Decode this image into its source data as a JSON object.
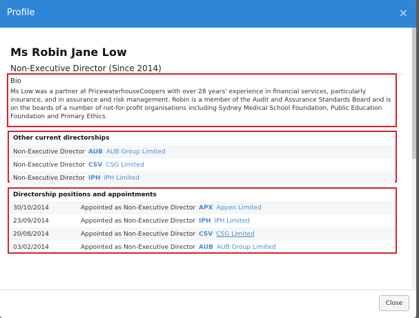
{
  "modal": {
    "title": "Profile",
    "close_icon": "×"
  },
  "person": {
    "name": "Ms Robin Jane Low",
    "role": "Non-Executive Director (Since 2014)"
  },
  "bio": {
    "label": "Bio",
    "text": "Ms Low was a partner at PricewaterhouseCoopers with over 28 years' experience in financial services, particularly insurance, and in assurance and risk management. Robin is a member of the Audit and Assurance Standards Board and is on the boards of a number of not-for-profit organisations including Sydney Medical School Foundation, Public Education Foundation and Primary Ethics."
  },
  "directorships": {
    "title": "Other current directorships",
    "rows": [
      {
        "role": "Non-Executive Director",
        "code": "AUB",
        "company": "AUB Group Limited"
      },
      {
        "role": "Non-Executive Director",
        "code": "CSV",
        "company": "CSG Limited"
      },
      {
        "role": "Non-Executive Director",
        "code": "IPH",
        "company": "IPH Limited"
      }
    ]
  },
  "appointments": {
    "title": "Directorship positions and appointments",
    "rows": [
      {
        "date": "30/10/2014",
        "text": "Appointed as Non-Executive Director",
        "code": "APX",
        "company": "Appen Limited"
      },
      {
        "date": "23/09/2014",
        "text": "Appointed as Non-Executive Director",
        "code": "IPH",
        "company": "IPH Limited"
      },
      {
        "date": "20/08/2014",
        "text": "Appointed as Non-Executive Director",
        "code": "CSV",
        "company": "CSG Limited"
      },
      {
        "date": "03/02/2014",
        "text": "Appointed as Non-Executive Director",
        "code": "AUB",
        "company": "AUB Group Limited"
      }
    ]
  },
  "footer": {
    "close_label": "Close"
  },
  "colors": {
    "header": "#2f86d6",
    "link": "#4a8fcf",
    "highlight_box": "#d9202a"
  }
}
